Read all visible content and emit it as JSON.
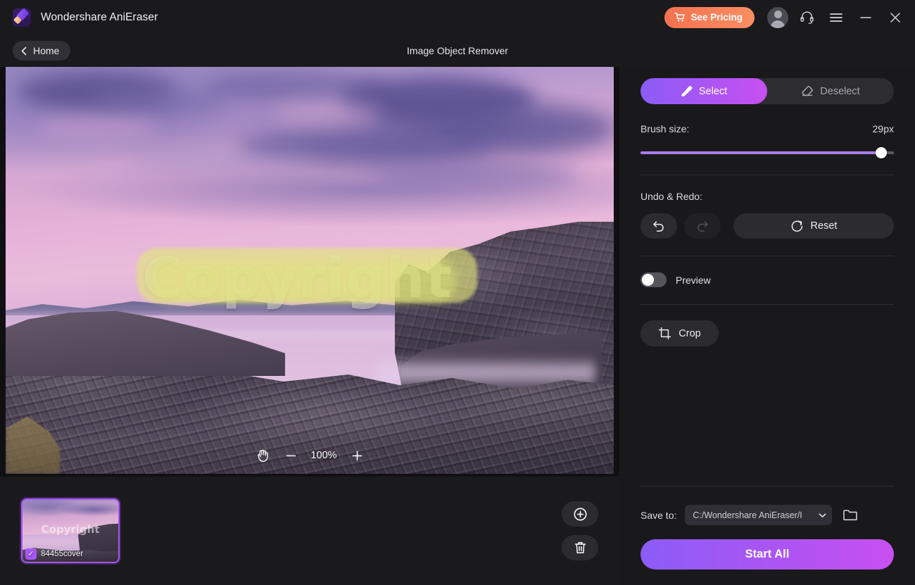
{
  "app": {
    "name": "Wondershare AniEraser",
    "logo_icon": "eraser-icon"
  },
  "titlebar": {
    "pricing_label": "See Pricing",
    "pricing_icon": "cart-icon",
    "pricing_color": "#f4714f",
    "avatar_icon": "user-avatar-icon",
    "support_icon": "headset-icon",
    "menu_icon": "hamburger-menu-icon",
    "minimize_icon": "minimize-icon",
    "close_icon": "close-icon"
  },
  "subbar": {
    "home_label": "Home",
    "back_icon": "chevron-left-icon",
    "page_title": "Image Object Remover"
  },
  "canvas": {
    "watermark_text": "Copyright",
    "mask_color": "#e2e678",
    "zoom": {
      "pan_icon": "hand-pan-icon",
      "zoom_out_icon": "minus-icon",
      "level": "100%",
      "zoom_in_icon": "plus-icon"
    }
  },
  "filmstrip": {
    "thumbnail": {
      "name": "84455cover",
      "watermark_text": "Copyright",
      "checked": true,
      "check_icon": "checkmark-icon"
    },
    "add_icon": "add-circle-icon",
    "delete_icon": "trash-icon"
  },
  "panel": {
    "mode": {
      "select_label": "Select",
      "select_icon": "brush-icon",
      "deselect_label": "Deselect",
      "deselect_icon": "eraser-icon",
      "active": "Select",
      "accent_from": "#8b5cf6",
      "accent_to": "#c84ff0"
    },
    "brush": {
      "label": "Brush size:",
      "value": "29px",
      "percent": 95
    },
    "undo_redo": {
      "label": "Undo & Redo:",
      "undo_icon": "undo-arrow-icon",
      "redo_icon": "redo-arrow-icon",
      "undo_enabled": true,
      "redo_enabled": false,
      "reset_label": "Reset",
      "reset_icon": "reset-circular-arrow-icon"
    },
    "preview": {
      "label": "Preview",
      "enabled": false
    },
    "crop": {
      "label": "Crop",
      "icon": "crop-icon"
    },
    "save": {
      "label": "Save to:",
      "path": "C:/Wondershare AniEraser/I",
      "dropdown_icon": "chevron-down-icon",
      "folder_icon": "folder-open-icon"
    },
    "start_label": "Start All"
  }
}
